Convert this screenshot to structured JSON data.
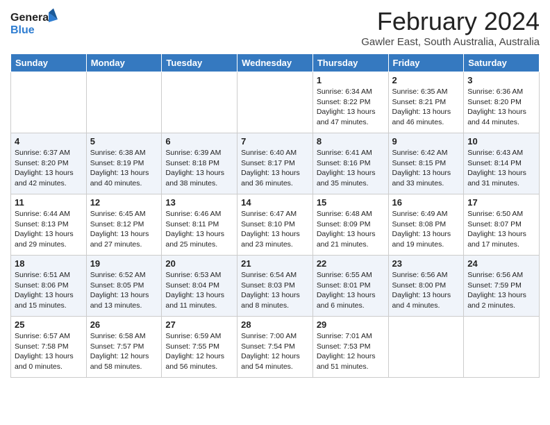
{
  "header": {
    "logo_line1": "General",
    "logo_line2": "Blue",
    "month_year": "February 2024",
    "location": "Gawler East, South Australia, Australia"
  },
  "weekdays": [
    "Sunday",
    "Monday",
    "Tuesday",
    "Wednesday",
    "Thursday",
    "Friday",
    "Saturday"
  ],
  "weeks": [
    [
      {
        "day": "",
        "info": ""
      },
      {
        "day": "",
        "info": ""
      },
      {
        "day": "",
        "info": ""
      },
      {
        "day": "",
        "info": ""
      },
      {
        "day": "1",
        "info": "Sunrise: 6:34 AM\nSunset: 8:22 PM\nDaylight: 13 hours\nand 47 minutes."
      },
      {
        "day": "2",
        "info": "Sunrise: 6:35 AM\nSunset: 8:21 PM\nDaylight: 13 hours\nand 46 minutes."
      },
      {
        "day": "3",
        "info": "Sunrise: 6:36 AM\nSunset: 8:20 PM\nDaylight: 13 hours\nand 44 minutes."
      }
    ],
    [
      {
        "day": "4",
        "info": "Sunrise: 6:37 AM\nSunset: 8:20 PM\nDaylight: 13 hours\nand 42 minutes."
      },
      {
        "day": "5",
        "info": "Sunrise: 6:38 AM\nSunset: 8:19 PM\nDaylight: 13 hours\nand 40 minutes."
      },
      {
        "day": "6",
        "info": "Sunrise: 6:39 AM\nSunset: 8:18 PM\nDaylight: 13 hours\nand 38 minutes."
      },
      {
        "day": "7",
        "info": "Sunrise: 6:40 AM\nSunset: 8:17 PM\nDaylight: 13 hours\nand 36 minutes."
      },
      {
        "day": "8",
        "info": "Sunrise: 6:41 AM\nSunset: 8:16 PM\nDaylight: 13 hours\nand 35 minutes."
      },
      {
        "day": "9",
        "info": "Sunrise: 6:42 AM\nSunset: 8:15 PM\nDaylight: 13 hours\nand 33 minutes."
      },
      {
        "day": "10",
        "info": "Sunrise: 6:43 AM\nSunset: 8:14 PM\nDaylight: 13 hours\nand 31 minutes."
      }
    ],
    [
      {
        "day": "11",
        "info": "Sunrise: 6:44 AM\nSunset: 8:13 PM\nDaylight: 13 hours\nand 29 minutes."
      },
      {
        "day": "12",
        "info": "Sunrise: 6:45 AM\nSunset: 8:12 PM\nDaylight: 13 hours\nand 27 minutes."
      },
      {
        "day": "13",
        "info": "Sunrise: 6:46 AM\nSunset: 8:11 PM\nDaylight: 13 hours\nand 25 minutes."
      },
      {
        "day": "14",
        "info": "Sunrise: 6:47 AM\nSunset: 8:10 PM\nDaylight: 13 hours\nand 23 minutes."
      },
      {
        "day": "15",
        "info": "Sunrise: 6:48 AM\nSunset: 8:09 PM\nDaylight: 13 hours\nand 21 minutes."
      },
      {
        "day": "16",
        "info": "Sunrise: 6:49 AM\nSunset: 8:08 PM\nDaylight: 13 hours\nand 19 minutes."
      },
      {
        "day": "17",
        "info": "Sunrise: 6:50 AM\nSunset: 8:07 PM\nDaylight: 13 hours\nand 17 minutes."
      }
    ],
    [
      {
        "day": "18",
        "info": "Sunrise: 6:51 AM\nSunset: 8:06 PM\nDaylight: 13 hours\nand 15 minutes."
      },
      {
        "day": "19",
        "info": "Sunrise: 6:52 AM\nSunset: 8:05 PM\nDaylight: 13 hours\nand 13 minutes."
      },
      {
        "day": "20",
        "info": "Sunrise: 6:53 AM\nSunset: 8:04 PM\nDaylight: 13 hours\nand 11 minutes."
      },
      {
        "day": "21",
        "info": "Sunrise: 6:54 AM\nSunset: 8:03 PM\nDaylight: 13 hours\nand 8 minutes."
      },
      {
        "day": "22",
        "info": "Sunrise: 6:55 AM\nSunset: 8:01 PM\nDaylight: 13 hours\nand 6 minutes."
      },
      {
        "day": "23",
        "info": "Sunrise: 6:56 AM\nSunset: 8:00 PM\nDaylight: 13 hours\nand 4 minutes."
      },
      {
        "day": "24",
        "info": "Sunrise: 6:56 AM\nSunset: 7:59 PM\nDaylight: 13 hours\nand 2 minutes."
      }
    ],
    [
      {
        "day": "25",
        "info": "Sunrise: 6:57 AM\nSunset: 7:58 PM\nDaylight: 13 hours\nand 0 minutes."
      },
      {
        "day": "26",
        "info": "Sunrise: 6:58 AM\nSunset: 7:57 PM\nDaylight: 12 hours\nand 58 minutes."
      },
      {
        "day": "27",
        "info": "Sunrise: 6:59 AM\nSunset: 7:55 PM\nDaylight: 12 hours\nand 56 minutes."
      },
      {
        "day": "28",
        "info": "Sunrise: 7:00 AM\nSunset: 7:54 PM\nDaylight: 12 hours\nand 54 minutes."
      },
      {
        "day": "29",
        "info": "Sunrise: 7:01 AM\nSunset: 7:53 PM\nDaylight: 12 hours\nand 51 minutes."
      },
      {
        "day": "",
        "info": ""
      },
      {
        "day": "",
        "info": ""
      }
    ]
  ]
}
